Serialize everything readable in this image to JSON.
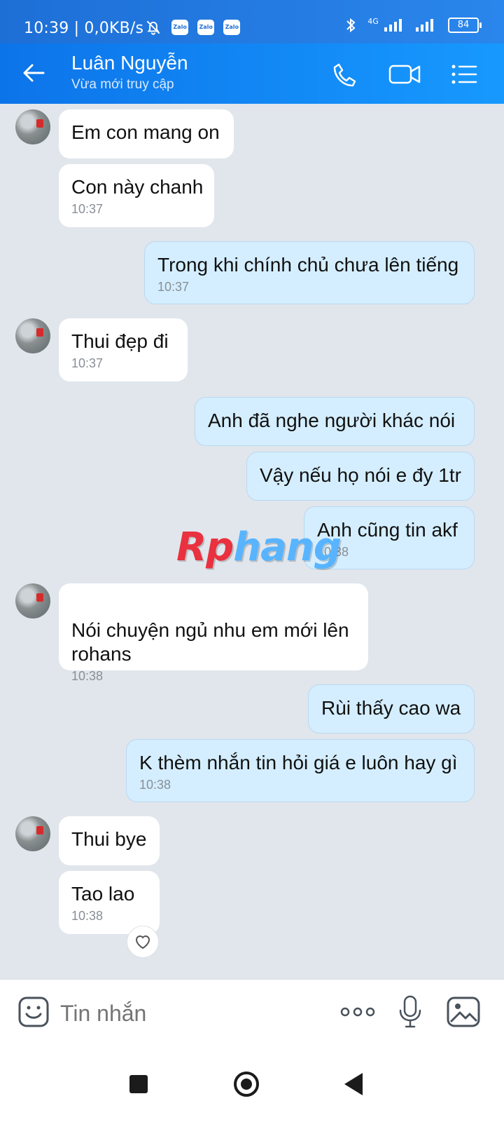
{
  "status_bar": {
    "time_speed": "10:39 | 0,0KB/s",
    "notification_icons": [
      "bell-off-icon",
      "zalo-icon",
      "zalo-icon",
      "zalo-icon"
    ],
    "zalo_label": "Zalo",
    "network_label": "4G",
    "battery": "84"
  },
  "header": {
    "name": "Luân Nguyễn",
    "status": "Vừa mới truy cập",
    "icons": [
      "back-arrow-icon",
      "phone-icon",
      "video-call-icon",
      "menu-icon"
    ]
  },
  "messages": [
    {
      "side": "left",
      "text": "Em con mang on",
      "time": ""
    },
    {
      "side": "left",
      "text": "Con này chanh",
      "time": "10:37"
    },
    {
      "side": "right",
      "text": "Trong khi chính chủ chưa lên tiếng",
      "time": "10:37"
    },
    {
      "side": "left",
      "text": "Thui đẹp đi",
      "time": "10:37"
    },
    {
      "side": "right",
      "text": "Anh đã nghe người khác nói",
      "time": ""
    },
    {
      "side": "right",
      "text": "Vậy nếu họ nói e đy 1tr",
      "time": ""
    },
    {
      "side": "right",
      "text": "Anh cũng tin akf",
      "time": "10:38"
    },
    {
      "side": "left",
      "text": "Nói chuyện ngủ nhu em mới lên\nrohans",
      "time": "10:38"
    },
    {
      "side": "right",
      "text": "Rùi thấy cao wa",
      "time": ""
    },
    {
      "side": "right",
      "text": "K thèm nhắn tin hỏi giá e luôn hay gì",
      "time": "10:38"
    },
    {
      "side": "left",
      "text": "Thui bye",
      "time": ""
    },
    {
      "side": "left",
      "text": "Tao lao",
      "time": "10:38"
    }
  ],
  "watermark": {
    "part1": "Rp",
    "part2": "hang"
  },
  "composer": {
    "placeholder": "Tin nhắn",
    "icons": [
      "emoji-icon",
      "more-icon",
      "microphone-icon",
      "image-icon"
    ]
  },
  "nav_icons": [
    "recent-apps-icon",
    "home-icon",
    "back-icon"
  ],
  "colors": {
    "accent": "#0c74e9",
    "incoming_bubble": "#ffffff",
    "outgoing_bubble": "#d4eeff",
    "chat_bg": "#e1e6ec"
  }
}
